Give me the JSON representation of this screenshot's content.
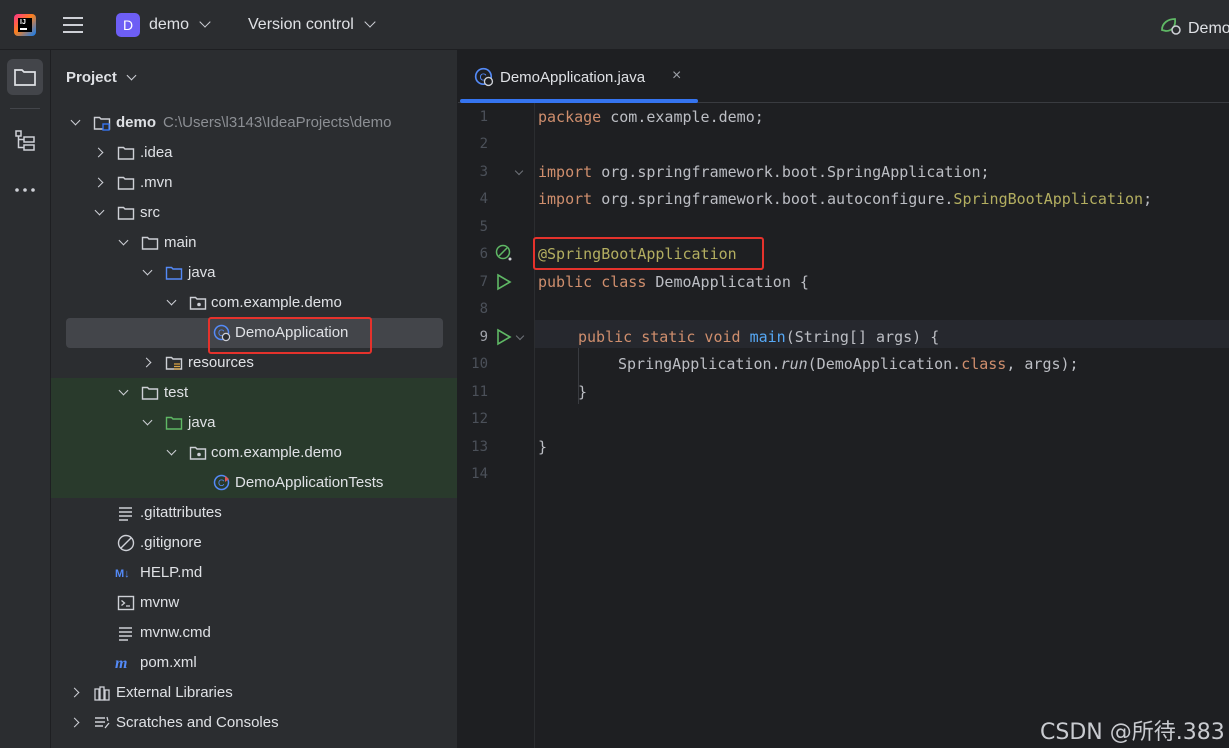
{
  "titlebar": {
    "project_badge": "D",
    "project_name": "demo",
    "vcs_menu": "Version control",
    "run_config": "Demo"
  },
  "project_panel": {
    "title": "Project",
    "tree": [
      {
        "label": "demo",
        "path": "C:\\Users\\l3143\\IdeaProjects\\demo",
        "icon": "module-folder-icon",
        "expanded": true
      },
      {
        "label": ".idea",
        "icon": "folder-icon",
        "expanded": false
      },
      {
        "label": ".mvn",
        "icon": "folder-icon",
        "expanded": false
      },
      {
        "label": "src",
        "icon": "folder-icon",
        "expanded": true
      },
      {
        "label": "main",
        "icon": "folder-icon",
        "expanded": true
      },
      {
        "label": "java",
        "icon": "source-folder-icon",
        "expanded": true
      },
      {
        "label": "com.example.demo",
        "icon": "package-icon",
        "expanded": true
      },
      {
        "label": "DemoApplication",
        "icon": "spring-boot-class-icon",
        "selected": true
      },
      {
        "label": "resources",
        "icon": "resources-folder-icon",
        "expanded": false
      },
      {
        "label": "test",
        "icon": "folder-icon",
        "expanded": true
      },
      {
        "label": "java",
        "icon": "test-source-folder-icon",
        "expanded": true
      },
      {
        "label": "com.example.demo",
        "icon": "package-icon",
        "expanded": true
      },
      {
        "label": "DemoApplicationTests",
        "icon": "test-class-icon"
      },
      {
        "label": ".gitattributes",
        "icon": "text-file-icon"
      },
      {
        "label": ".gitignore",
        "icon": "ignore-file-icon"
      },
      {
        "label": "HELP.md",
        "icon": "markdown-icon"
      },
      {
        "label": "mvnw",
        "icon": "shell-script-icon"
      },
      {
        "label": "mvnw.cmd",
        "icon": "text-file-icon"
      },
      {
        "label": "pom.xml",
        "icon": "maven-icon"
      },
      {
        "label": "External Libraries",
        "icon": "libraries-icon",
        "expanded": false
      },
      {
        "label": "Scratches and Consoles",
        "icon": "scratches-icon",
        "expanded": false
      }
    ]
  },
  "editor": {
    "tab_label": "DemoApplication.java",
    "tab_close": "×",
    "line_numbers": [
      "1",
      "2",
      "3",
      "4",
      "5",
      "6",
      "7",
      "8",
      "9",
      "10",
      "11",
      "12",
      "13",
      "14"
    ],
    "code": {
      "l1_kw": "package",
      "l1_rest": " com.example.demo;",
      "l3_kw": "import",
      "l3_rest": " org.springframework.boot.SpringApplication;",
      "l4_kw": "import",
      "l4_rest": " org.springframework.boot.autoconfigure.",
      "l4_ann": "SpringBootApplication",
      "l4_end": ";",
      "l6_ann": "@SpringBootApplication",
      "l7_kw": "public class",
      "l7_rest": " DemoApplication {",
      "l9_kw": "public static void",
      "l9_fn": "main",
      "l9_rest": "(String[] args) {",
      "l10_a": "SpringApplication.",
      "l10_run": "run",
      "l10_b": "(DemoApplication.",
      "l10_cls": "class",
      "l10_c": ", args);",
      "l11": "}",
      "l13": "}"
    }
  },
  "watermark": "CSDN @所待.383",
  "colors": {
    "accent": "#3574f0",
    "highlight_box": "#e5322c",
    "keyword": "#cf8e6d",
    "annotation": "#b3ae60",
    "function": "#56a8f5"
  }
}
